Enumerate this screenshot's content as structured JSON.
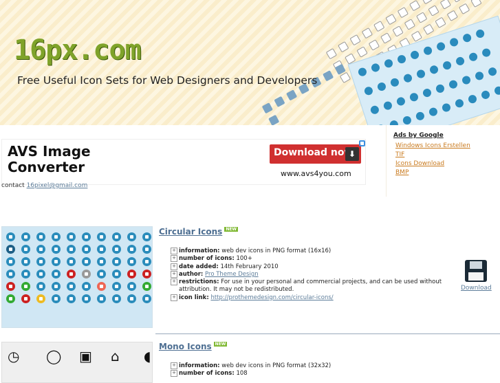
{
  "header": {
    "logo": "16px.com",
    "tagline": "Free Useful Icon Sets for Web Designers and Developers"
  },
  "ad": {
    "title": "AVS Image Converter",
    "download_label": "Download now",
    "url": "www.avs4you.com"
  },
  "contact": {
    "label": "contact",
    "email": "16pixel@gmail.com"
  },
  "ads_by_google": {
    "heading": "Ads by Google",
    "links": [
      "Windows Icons Erstellen",
      "TIF",
      "Icons Download",
      "BMP"
    ]
  },
  "entries": [
    {
      "title": "Circular Icons",
      "badge": "NEW",
      "information_label": "information:",
      "information": "web dev icons in PNG format (16x16)",
      "count_label": "number of icons:",
      "count": "100+",
      "date_label": "date added:",
      "date": "14th February 2010",
      "author_label": "author:",
      "author": "Pro Theme Design",
      "restrictions_label": "restrictions:",
      "restrictions": "For use in your personal and commercial projects, and can be used without attribution. It may not be redistributed.",
      "icon_link_label": "icon link:",
      "icon_link": "http://prothemedesign.com/circular-icons/",
      "download_label": "Download"
    },
    {
      "title": "Mono Icons",
      "badge": "NEW",
      "information_label": "information:",
      "information": "web dev icons in PNG format (32x32)",
      "count_label": "number of icons:",
      "count": "108"
    }
  ],
  "colors": {
    "logo_green": "#7fa32a",
    "link_blue": "#4e6f92",
    "ad_red": "#d03030",
    "ads_orange": "#c97a1e"
  }
}
